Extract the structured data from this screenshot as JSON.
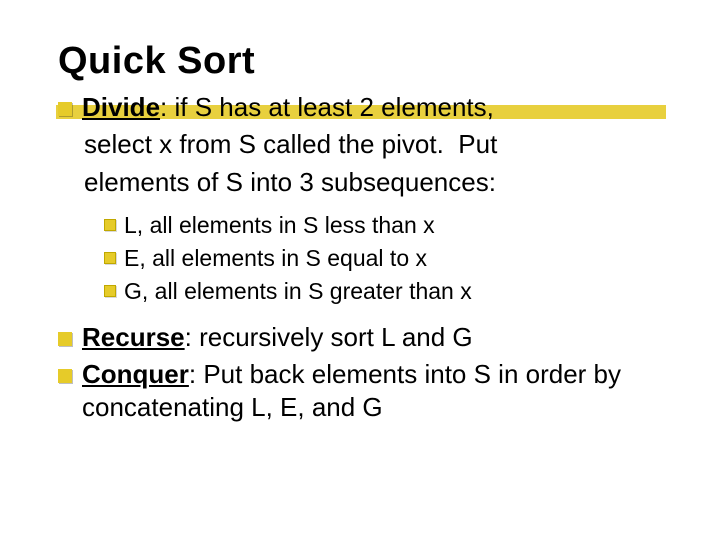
{
  "title": "Quick Sort",
  "items": [
    {
      "label": "Divide",
      "text": ": if S has at least 2 elements, select x from S called the pivot.  Put elements of S into 3 subsequences:",
      "sub": [
        {
          "text": "L, all elements in S less than x"
        },
        {
          "text": "E, all elements in S equal to x"
        },
        {
          "text": "G, all elements in S greater than x"
        }
      ]
    },
    {
      "label": "Recurse",
      "text": ": recursively sort L and G"
    },
    {
      "label": "Conquer",
      "text": ": Put back elements into S in order by concatenating L,  E, and G"
    }
  ]
}
